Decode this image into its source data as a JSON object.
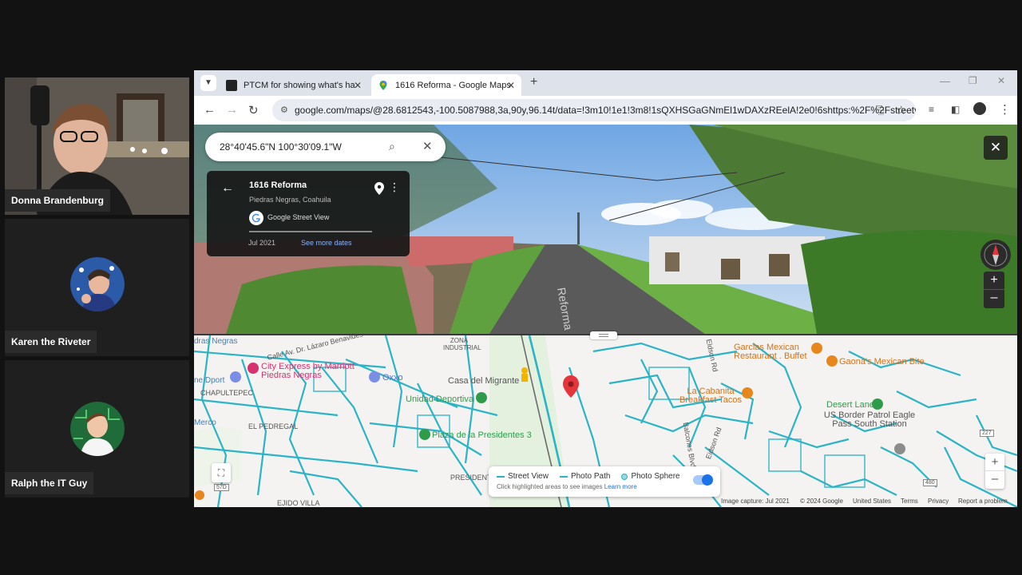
{
  "participants": [
    {
      "name": "Donna Brandenburg",
      "has_video": true
    },
    {
      "name": "Karen the Riveter",
      "has_video": false
    },
    {
      "name": "Ralph the IT Guy",
      "has_video": false
    }
  ],
  "browser": {
    "tabs": [
      {
        "title": "PTCM for showing what's happ",
        "active": false,
        "icon": "ptcm-icon"
      },
      {
        "title": "1616 Reforma - Google Maps",
        "active": true,
        "icon": "maps-pin-icon"
      }
    ],
    "new_tab_label": "+",
    "url": "google.com/maps/@28.6812543,-100.5087988,3a,90y,96.14t/data=!3m10!1e1!3m8!1sQXHSGaGNmEl1wDAXzREelA!2e0!6shttps:%2F%2Fstreetvi..."
  },
  "streetview": {
    "search_value": "28°40'45.6\"N 100°30'09.1\"W",
    "place_title": "1616 Reforma",
    "place_subtitle": "Piedras Negras, Coahuila",
    "source_label": "Google Street View",
    "date": "Jul 2021",
    "more_dates_link": "See more dates",
    "street_label": "Reforma"
  },
  "map": {
    "labels": [
      "dras Negras",
      "Calle Av. Dr. Lázaro Benavides",
      "ZONA INDUSTRIAL",
      "ne Dport",
      "CHAPULTEPEC",
      "Merco",
      "EL PEDREGAL",
      "PRESIDENT",
      "EJIDO VILLA",
      "Eldson Rd",
      "Balcones Blvd",
      "Eidson Rd"
    ],
    "pois": {
      "city_express": "City Express by Marriott Piedras Negras",
      "oxxo": "Oxxo",
      "casa_migrante": "Casa del Migrante",
      "unidad_deportiva": "Unidad Deportiva",
      "plaza_presidentes": "Plaza de la Presidentes 3",
      "garcias": "Garcias Mexican Restaurant . Buffet",
      "gaonas": "Gaona's Mexican Bite",
      "la_cabanita": "La Cabanita Breakfast Tacos",
      "desert_lanes": "Desert Lanes",
      "border_patrol": "US Border Patrol Eagle Pass South Station"
    },
    "legend": {
      "street_view": "Street View",
      "photo_path": "Photo Path",
      "photo_sphere": "Photo Sphere",
      "hint": "Click highlighted areas to see images",
      "learn_more": "Learn more"
    },
    "footer": {
      "capture": "Image capture: Jul 2021",
      "copyright": "© 2024 Google",
      "country": "United States",
      "terms": "Terms",
      "privacy": "Privacy",
      "report": "Report a problem"
    },
    "road_shields": [
      "227",
      "480",
      "57D"
    ]
  },
  "colors": {
    "map_road": "#2bb3c7",
    "pin": "#e4353a",
    "poi_food": "#e8861e",
    "poi_green": "#2f9c4a",
    "poi_pink": "#d6326f"
  }
}
